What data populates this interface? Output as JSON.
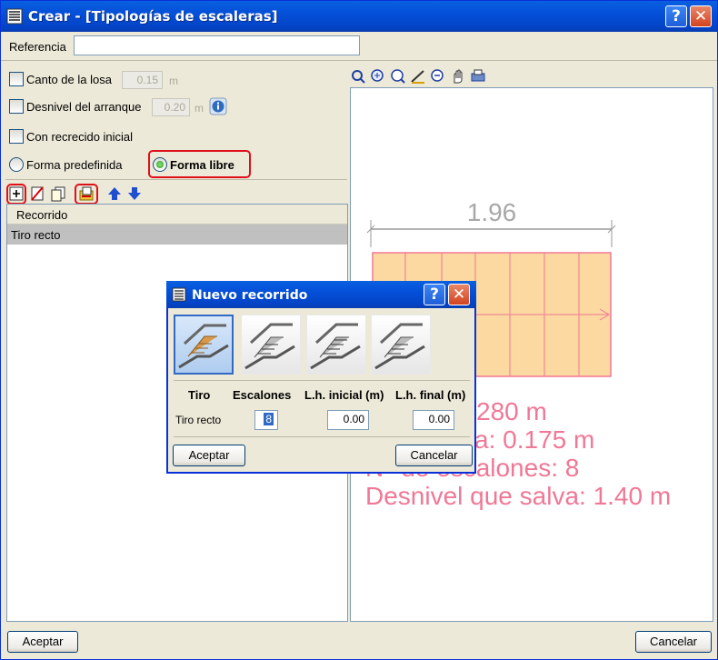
{
  "window": {
    "title": "Crear - [Tipologías de escaleras]",
    "help_glyph": "?",
    "close_glyph": "✕"
  },
  "referencia": {
    "label": "Referencia",
    "value": ""
  },
  "options": {
    "canto_label": "Canto de la losa",
    "canto_value": "0.15",
    "canto_unit": "m",
    "desnivel_label": "Desnivel del arranque",
    "desnivel_value": "0.20",
    "desnivel_unit": "m",
    "recrecido_label": "Con recrecido inicial",
    "forma_predefinida_label": "Forma predefinida",
    "forma_libre_label": "Forma libre"
  },
  "list": {
    "header": "Recorrido",
    "rows": [
      "Tiro recto"
    ]
  },
  "canvas": {
    "dimension": "1.96",
    "text_lines": [
      "280 m",
      "ella: 0.175 m",
      "N° de escalones: 8",
      "Desnivel que salva: 1.40 m"
    ],
    "stair_color": "#FCD9A0",
    "accent_color": "#F07896"
  },
  "dialog": {
    "title": "Nuevo recorrido",
    "headers": {
      "tiro": "Tiro",
      "escalones": "Escalones",
      "lh_inicial": "L.h. inicial (m)",
      "lh_final": "L.h. final (m)"
    },
    "row": {
      "tiro": "Tiro recto",
      "escalones": "8",
      "lh_inicial": "0.00",
      "lh_final": "0.00"
    },
    "accept": "Aceptar",
    "cancel": "Cancelar"
  },
  "buttons": {
    "accept": "Aceptar",
    "cancel": "Cancelar"
  },
  "icons": {
    "toolbar_left": [
      "add-icon",
      "delete-icon",
      "copy-icon",
      "import-icon",
      "arrow-up-icon",
      "arrow-down-icon"
    ],
    "toolbar_right": [
      "redraw-icon",
      "zoom-window-icon",
      "zoom-icon",
      "measure-icon",
      "zoom-out-icon",
      "pan-hand-icon",
      "print-icon"
    ]
  }
}
